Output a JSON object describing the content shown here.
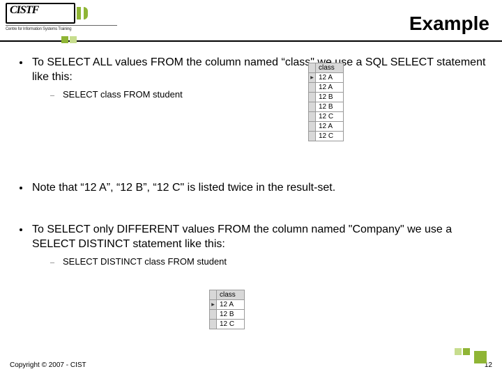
{
  "logo": {
    "main": "CISTF",
    "sub": "Centre for Information Systems Training"
  },
  "title": "Example",
  "b1": "To SELECT ALL values FROM the column named “class\" we use a SQL SELECT statement like this:",
  "s1": "SELECT class FROM student",
  "t1": {
    "header": "class",
    "rows": [
      "12 A",
      "12 A",
      "12 B",
      "12 B",
      "12 C",
      "12 A",
      "12 C"
    ]
  },
  "b2": "Note that “12 A”, “12 B”, “12 C\" is listed twice in the result-set.",
  "b3": "To SELECT only DIFFERENT values FROM the column named \"Company\" we use a SELECT DISTINCT statement like this:",
  "s3": "SELECT DISTINCT class FROM student",
  "t2": {
    "header": "class",
    "rows": [
      "12 A",
      "12 B",
      "12 C"
    ]
  },
  "footer": "Copyright © 2007 - CIST",
  "page": "12"
}
